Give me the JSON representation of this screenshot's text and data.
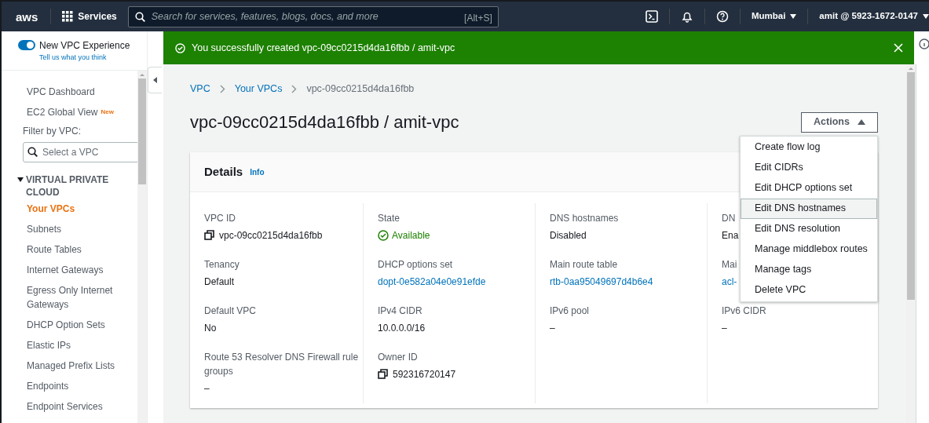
{
  "nav": {
    "logo": "aws",
    "services": "Services",
    "search": {
      "placeholder": "Search for services, features, blogs, docs, and more",
      "shortcut": "[Alt+S]"
    },
    "region": "Mumbai",
    "account": "amit @ 5923-1672-0147"
  },
  "sidebar": {
    "toggle": {
      "label": "New VPC Experience",
      "on": true
    },
    "feedback": "Tell us what you think",
    "links": [
      {
        "label": "VPC Dashboard"
      },
      {
        "label": "EC2 Global View",
        "badge": "New"
      }
    ],
    "filter": {
      "label": "Filter by VPC:",
      "placeholder": "Select a VPC"
    },
    "section": {
      "title": "VIRTUAL PRIVATE CLOUD",
      "expanded": true,
      "items": [
        {
          "label": "Your VPCs",
          "selected": true
        },
        {
          "label": "Subnets",
          "selected": false
        },
        {
          "label": "Route Tables",
          "selected": false
        },
        {
          "label": "Internet Gateways",
          "selected": false
        },
        {
          "label": "Egress Only Internet Gateways",
          "selected": false
        },
        {
          "label": "DHCP Option Sets",
          "selected": false
        },
        {
          "label": "Elastic IPs",
          "selected": false
        },
        {
          "label": "Managed Prefix Lists",
          "selected": false
        },
        {
          "label": "Endpoints",
          "selected": false
        },
        {
          "label": "Endpoint Services",
          "selected": false
        }
      ]
    }
  },
  "banner": {
    "message": "You successfully created vpc-09cc0215d4da16fbb / amit-vpc"
  },
  "breadcrumbs": [
    {
      "label": "VPC",
      "link": true
    },
    {
      "label": "Your VPCs",
      "link": true
    },
    {
      "label": "vpc-09cc0215d4da16fbb",
      "link": false
    }
  ],
  "title": "vpc-09cc0215d4da16fbb / amit-vpc",
  "actions": {
    "label": "Actions",
    "expanded": true,
    "menu": [
      {
        "label": "Create flow log",
        "selected": false
      },
      {
        "label": "Edit CIDRs",
        "selected": false
      },
      {
        "label": "Edit DHCP options set",
        "selected": false
      },
      {
        "label": "Edit DNS hostnames",
        "selected": true
      },
      {
        "label": "Edit DNS resolution",
        "selected": false
      },
      {
        "label": "Manage middlebox routes",
        "selected": false
      },
      {
        "label": "Manage tags",
        "selected": false
      },
      {
        "label": "Delete VPC",
        "selected": false
      }
    ]
  },
  "details": {
    "title": "Details",
    "info": "Info",
    "columns": [
      [
        {
          "label": "VPC ID",
          "value": "vpc-09cc0215d4da16fbb",
          "kind": "copy"
        },
        {
          "label": "Tenancy",
          "value": "Default",
          "kind": "text"
        },
        {
          "label": "Default VPC",
          "value": "No",
          "kind": "text"
        },
        {
          "label": "Route 53 Resolver DNS Firewall rule groups",
          "value": "–",
          "kind": "text"
        }
      ],
      [
        {
          "label": "State",
          "value": "Available",
          "kind": "status"
        },
        {
          "label": "DHCP options set",
          "value": "dopt-0e582a04e0e91efde",
          "kind": "link"
        },
        {
          "label": "IPv4 CIDR",
          "value": "10.0.0.0/16",
          "kind": "text"
        },
        {
          "label": "Owner ID",
          "value": "592316720147",
          "kind": "copy"
        }
      ],
      [
        {
          "label": "DNS hostnames",
          "value": "Disabled",
          "kind": "text"
        },
        {
          "label": "Main route table",
          "value": "rtb-0aa95049697d4b6e4",
          "kind": "link"
        },
        {
          "label": "IPv6 pool",
          "value": "–",
          "kind": "text"
        }
      ],
      [
        {
          "label": "DN",
          "value": "Ena",
          "kind": "text"
        },
        {
          "label": "Mai",
          "value": "acl-",
          "kind": "link"
        },
        {
          "label": "IPv6 CIDR",
          "value": "–",
          "kind": "text"
        }
      ]
    ]
  }
}
